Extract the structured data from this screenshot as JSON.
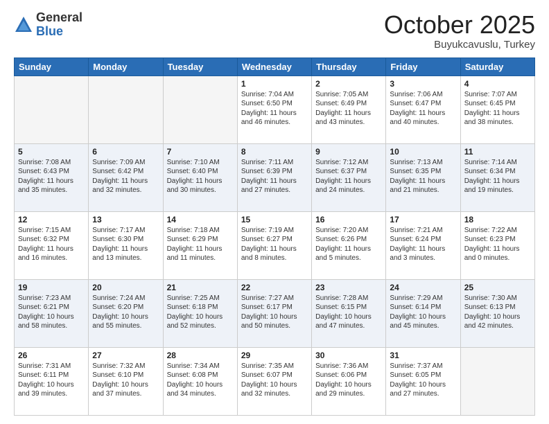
{
  "header": {
    "logo_general": "General",
    "logo_blue": "Blue",
    "title": "October 2025",
    "subtitle": "Buyukcavuslu, Turkey"
  },
  "days_of_week": [
    "Sunday",
    "Monday",
    "Tuesday",
    "Wednesday",
    "Thursday",
    "Friday",
    "Saturday"
  ],
  "weeks": [
    [
      {
        "day": "",
        "info": ""
      },
      {
        "day": "",
        "info": ""
      },
      {
        "day": "",
        "info": ""
      },
      {
        "day": "1",
        "info": "Sunrise: 7:04 AM\nSunset: 6:50 PM\nDaylight: 11 hours and 46 minutes."
      },
      {
        "day": "2",
        "info": "Sunrise: 7:05 AM\nSunset: 6:49 PM\nDaylight: 11 hours and 43 minutes."
      },
      {
        "day": "3",
        "info": "Sunrise: 7:06 AM\nSunset: 6:47 PM\nDaylight: 11 hours and 40 minutes."
      },
      {
        "day": "4",
        "info": "Sunrise: 7:07 AM\nSunset: 6:45 PM\nDaylight: 11 hours and 38 minutes."
      }
    ],
    [
      {
        "day": "5",
        "info": "Sunrise: 7:08 AM\nSunset: 6:43 PM\nDaylight: 11 hours and 35 minutes."
      },
      {
        "day": "6",
        "info": "Sunrise: 7:09 AM\nSunset: 6:42 PM\nDaylight: 11 hours and 32 minutes."
      },
      {
        "day": "7",
        "info": "Sunrise: 7:10 AM\nSunset: 6:40 PM\nDaylight: 11 hours and 30 minutes."
      },
      {
        "day": "8",
        "info": "Sunrise: 7:11 AM\nSunset: 6:39 PM\nDaylight: 11 hours and 27 minutes."
      },
      {
        "day": "9",
        "info": "Sunrise: 7:12 AM\nSunset: 6:37 PM\nDaylight: 11 hours and 24 minutes."
      },
      {
        "day": "10",
        "info": "Sunrise: 7:13 AM\nSunset: 6:35 PM\nDaylight: 11 hours and 21 minutes."
      },
      {
        "day": "11",
        "info": "Sunrise: 7:14 AM\nSunset: 6:34 PM\nDaylight: 11 hours and 19 minutes."
      }
    ],
    [
      {
        "day": "12",
        "info": "Sunrise: 7:15 AM\nSunset: 6:32 PM\nDaylight: 11 hours and 16 minutes."
      },
      {
        "day": "13",
        "info": "Sunrise: 7:17 AM\nSunset: 6:30 PM\nDaylight: 11 hours and 13 minutes."
      },
      {
        "day": "14",
        "info": "Sunrise: 7:18 AM\nSunset: 6:29 PM\nDaylight: 11 hours and 11 minutes."
      },
      {
        "day": "15",
        "info": "Sunrise: 7:19 AM\nSunset: 6:27 PM\nDaylight: 11 hours and 8 minutes."
      },
      {
        "day": "16",
        "info": "Sunrise: 7:20 AM\nSunset: 6:26 PM\nDaylight: 11 hours and 5 minutes."
      },
      {
        "day": "17",
        "info": "Sunrise: 7:21 AM\nSunset: 6:24 PM\nDaylight: 11 hours and 3 minutes."
      },
      {
        "day": "18",
        "info": "Sunrise: 7:22 AM\nSunset: 6:23 PM\nDaylight: 11 hours and 0 minutes."
      }
    ],
    [
      {
        "day": "19",
        "info": "Sunrise: 7:23 AM\nSunset: 6:21 PM\nDaylight: 10 hours and 58 minutes."
      },
      {
        "day": "20",
        "info": "Sunrise: 7:24 AM\nSunset: 6:20 PM\nDaylight: 10 hours and 55 minutes."
      },
      {
        "day": "21",
        "info": "Sunrise: 7:25 AM\nSunset: 6:18 PM\nDaylight: 10 hours and 52 minutes."
      },
      {
        "day": "22",
        "info": "Sunrise: 7:27 AM\nSunset: 6:17 PM\nDaylight: 10 hours and 50 minutes."
      },
      {
        "day": "23",
        "info": "Sunrise: 7:28 AM\nSunset: 6:15 PM\nDaylight: 10 hours and 47 minutes."
      },
      {
        "day": "24",
        "info": "Sunrise: 7:29 AM\nSunset: 6:14 PM\nDaylight: 10 hours and 45 minutes."
      },
      {
        "day": "25",
        "info": "Sunrise: 7:30 AM\nSunset: 6:13 PM\nDaylight: 10 hours and 42 minutes."
      }
    ],
    [
      {
        "day": "26",
        "info": "Sunrise: 7:31 AM\nSunset: 6:11 PM\nDaylight: 10 hours and 39 minutes."
      },
      {
        "day": "27",
        "info": "Sunrise: 7:32 AM\nSunset: 6:10 PM\nDaylight: 10 hours and 37 minutes."
      },
      {
        "day": "28",
        "info": "Sunrise: 7:34 AM\nSunset: 6:08 PM\nDaylight: 10 hours and 34 minutes."
      },
      {
        "day": "29",
        "info": "Sunrise: 7:35 AM\nSunset: 6:07 PM\nDaylight: 10 hours and 32 minutes."
      },
      {
        "day": "30",
        "info": "Sunrise: 7:36 AM\nSunset: 6:06 PM\nDaylight: 10 hours and 29 minutes."
      },
      {
        "day": "31",
        "info": "Sunrise: 7:37 AM\nSunset: 6:05 PM\nDaylight: 10 hours and 27 minutes."
      },
      {
        "day": "",
        "info": ""
      }
    ]
  ]
}
